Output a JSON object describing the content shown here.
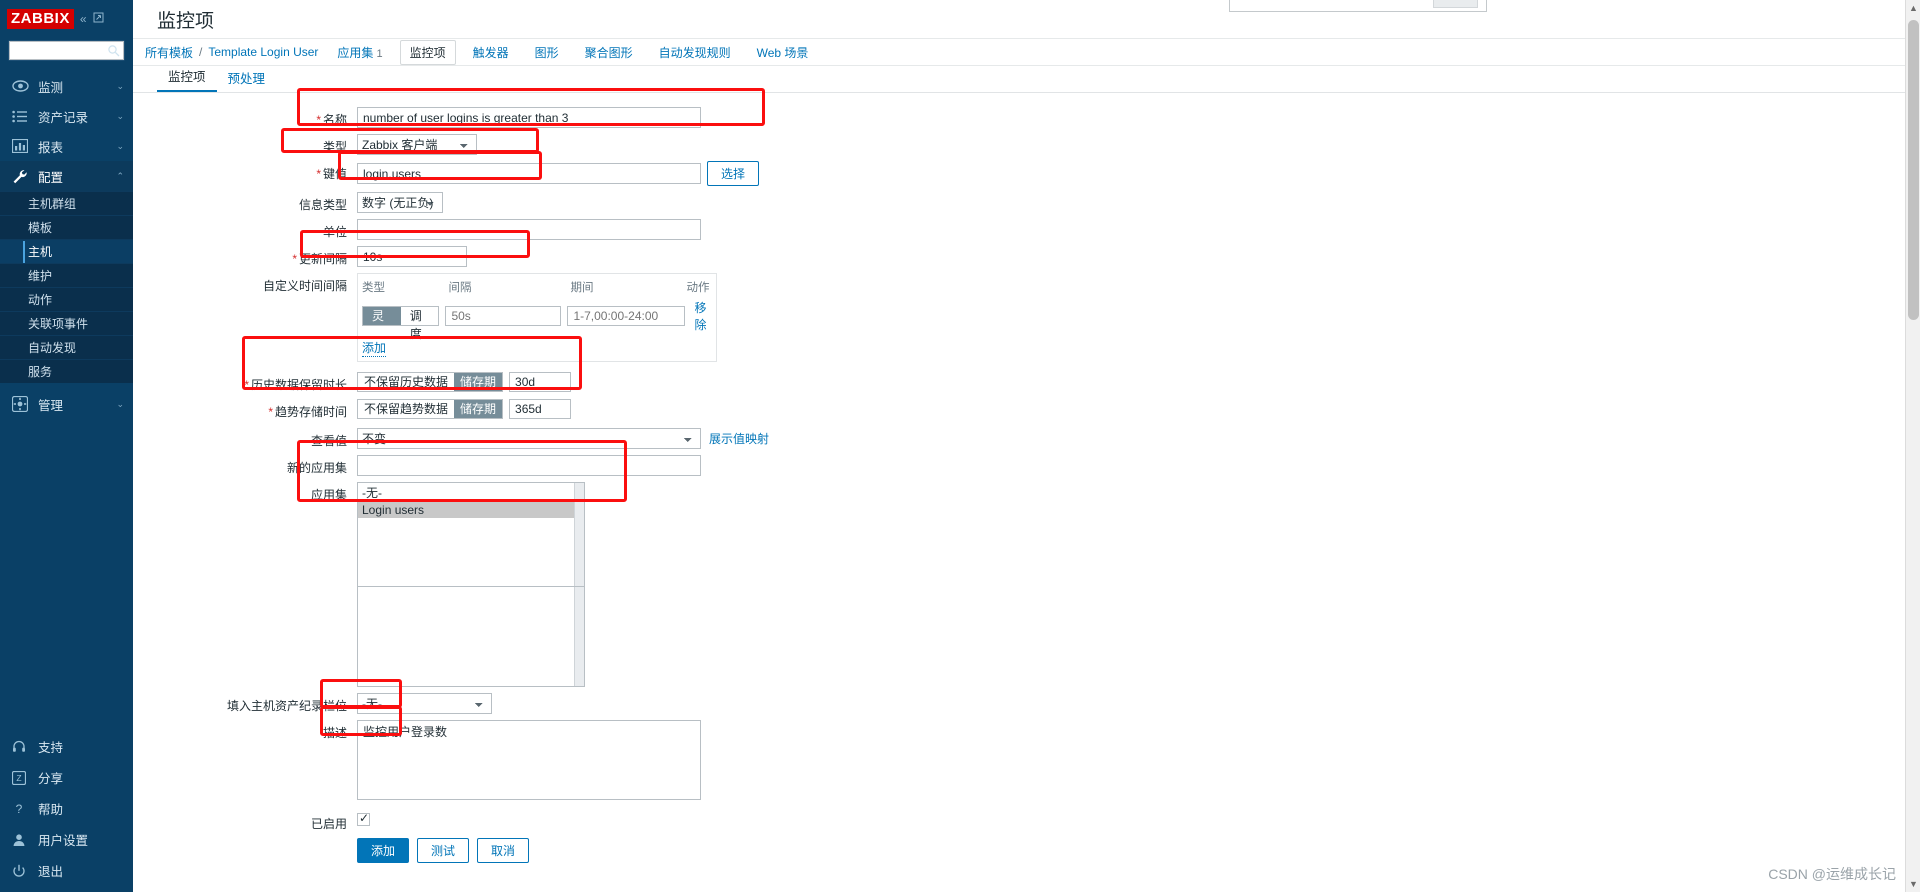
{
  "sidebar": {
    "logo": "ZABBIX",
    "collapse_icon": "chevrons-left-icon",
    "expand_icon": "expand-icon",
    "search": {
      "value": "",
      "placeholder": ""
    },
    "nav": [
      {
        "label": "监测",
        "icon": "eye-icon",
        "chevron": "⌄",
        "active": false
      },
      {
        "label": "资产记录",
        "icon": "list-icon",
        "chevron": "⌄",
        "active": false
      },
      {
        "label": "报表",
        "icon": "bar-chart-icon",
        "chevron": "⌄",
        "active": false
      },
      {
        "label": "配置",
        "icon": "wrench-icon",
        "chevron": "⌃",
        "active": true
      }
    ],
    "sub_items": [
      {
        "label": "主机群组",
        "selected": false
      },
      {
        "label": "模板",
        "selected": false
      },
      {
        "label": "主机",
        "selected": true
      },
      {
        "label": "维护",
        "selected": false
      },
      {
        "label": "动作",
        "selected": false
      },
      {
        "label": "关联项事件",
        "selected": false
      },
      {
        "label": "自动发现",
        "selected": false
      },
      {
        "label": "服务",
        "selected": false
      }
    ],
    "admin": {
      "label": "管理",
      "icon": "gear-icon",
      "chevron": "⌄"
    },
    "footer": [
      {
        "label": "支持",
        "icon": "headset-icon"
      },
      {
        "label": "分享",
        "icon": "zabbix-share-icon"
      },
      {
        "label": "帮助",
        "icon": "question-icon"
      },
      {
        "label": "用户设置",
        "icon": "user-icon"
      },
      {
        "label": "退出",
        "icon": "power-icon"
      }
    ]
  },
  "header": {
    "title": "监控项"
  },
  "breadcrumb": {
    "root": "所有模板",
    "separator": "/",
    "template": "Template Login User",
    "tabs": [
      {
        "label": "应用集",
        "count": "1",
        "current": false
      },
      {
        "label": "监控项",
        "count": "",
        "current": true
      },
      {
        "label": "触发器",
        "count": "",
        "current": false
      },
      {
        "label": "图形",
        "count": "",
        "current": false
      },
      {
        "label": "聚合图形",
        "count": "",
        "current": false
      },
      {
        "label": "自动发现规则",
        "count": "",
        "current": false
      },
      {
        "label": "Web 场景",
        "count": "",
        "current": false
      }
    ]
  },
  "tabs": [
    {
      "label": "监控项",
      "active": true
    },
    {
      "label": "预处理",
      "active": false
    }
  ],
  "form": {
    "name": {
      "label": "名称",
      "required": true,
      "value": "number of user logins is greater than 3"
    },
    "type": {
      "label": "类型",
      "required": false,
      "value": "Zabbix 客户端"
    },
    "key": {
      "label": "键值",
      "required": true,
      "value": "login.users",
      "select_button": "选择"
    },
    "info_type": {
      "label": "信息类型",
      "required": false,
      "value": "数字 (无正负)"
    },
    "unit": {
      "label": "单位",
      "required": false,
      "value": ""
    },
    "update_interval": {
      "label": "更新间隔",
      "required": true,
      "value": "10s"
    },
    "custom_intervals": {
      "label": "自定义时间间隔",
      "columns": [
        "类型",
        "间隔",
        "期间",
        "动作"
      ],
      "rows": [
        {
          "type_flexible": "灵活",
          "type_scheduled": "调度",
          "type_selected": "灵活",
          "interval_placeholder": "50s",
          "interval_value": "",
          "period_placeholder": "1-7,00:00-24:00",
          "period_value": "",
          "action": "移除"
        }
      ],
      "add_label": "添加"
    },
    "history": {
      "label": "历史数据保留时长",
      "required": true,
      "option_off": "不保留历史数据",
      "option_on": "储存期",
      "selected": "储存期",
      "value": "30d"
    },
    "trends": {
      "label": "趋势存储时间",
      "required": true,
      "option_off": "不保留趋势数据",
      "option_on": "储存期",
      "selected": "储存期",
      "value": "365d"
    },
    "value_map": {
      "label": "查看值",
      "value": "不变",
      "link": "展示值映射"
    },
    "new_application": {
      "label": "新的应用集",
      "value": "",
      "placeholder": ""
    },
    "applications": {
      "label": "应用集",
      "options": [
        {
          "label": "-无-",
          "selected": false
        },
        {
          "label": "Login users",
          "selected": true
        }
      ]
    },
    "inventory_field": {
      "label": "填入主机资产纪录栏位",
      "value": "-无-"
    },
    "description": {
      "label": "描述",
      "value": "监控用户登录数"
    },
    "enabled": {
      "label": "已启用",
      "checked": true
    }
  },
  "buttons": {
    "add": "添加",
    "test": "测试",
    "cancel": "取消"
  },
  "watermark": "CSDN @运维成长记",
  "colors": {
    "accent": "#0275b8",
    "sidebar_bg": "#0a4066",
    "logo_red": "#d40000",
    "annotation_red": "#fb0f0f",
    "required_red": "#d42d2d",
    "segment_on": "#768d99"
  }
}
